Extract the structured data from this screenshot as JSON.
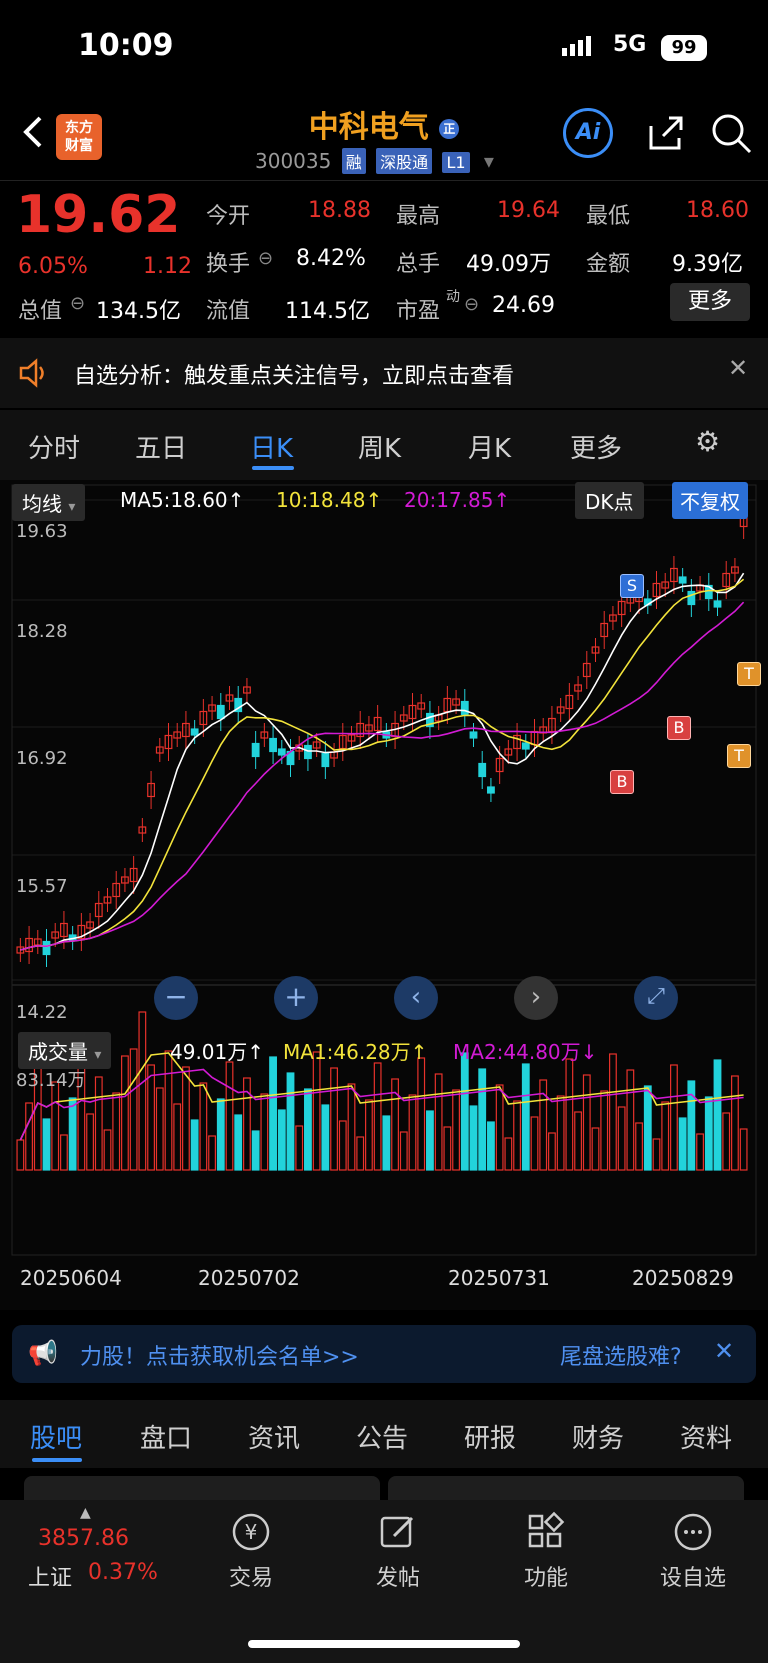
{
  "status_bar": {
    "time": "10:09",
    "network": "5G",
    "battery": "99"
  },
  "header": {
    "app_logo": "东方\n财富",
    "stock_name": "中科电气",
    "stock_code": "300035",
    "tags": [
      "融",
      "深股通",
      "L1"
    ],
    "ai_label": "Ai"
  },
  "quote": {
    "price": "19.62",
    "change_pct": "6.05%",
    "change": "1.12",
    "open_label": "今开",
    "open": "18.88",
    "high_label": "最高",
    "high": "19.64",
    "low_label": "最低",
    "low": "18.60",
    "turnover_label": "换手",
    "turnover": "8.42%",
    "volume_label": "总手",
    "volume": "49.09万",
    "amount_label": "金额",
    "amount": "9.39亿",
    "mktcap_label": "总值",
    "mktcap": "134.5亿",
    "float_label": "流值",
    "float": "114.5亿",
    "pe_label": "市盈",
    "pe_sup": "动",
    "pe": "24.69",
    "more": "更多"
  },
  "alert": {
    "text": "自选分析：触发重点关注信号，立即点击查看"
  },
  "chart_tabs": [
    "分时",
    "五日",
    "日K",
    "周K",
    "月K",
    "更多"
  ],
  "active_chart_tab": "日K",
  "chart": {
    "indicator_select": "均线",
    "ma5": "MA5:18.60",
    "ma10": "10:18.48",
    "ma20": "20:17.85",
    "dk_button": "DK点",
    "fq_button": "不复权",
    "y_labels": [
      "19.63",
      "18.28",
      "16.92",
      "15.57",
      "14.22"
    ],
    "volume_select": "成交量",
    "vol": "49.01万",
    "vol_ma1": "MA1:46.28万",
    "vol_ma2": "MA2:44.80万",
    "vol_top": "83.14万",
    "dates": [
      "20250604",
      "20250702",
      "20250731",
      "20250829"
    ],
    "markers": {
      "s": "S",
      "b": "B",
      "t": "T"
    },
    "colors": {
      "up": "#e8322b",
      "down": "#22d3db",
      "ma5": "#ffffff",
      "ma10": "#f2e33b",
      "ma20": "#d21bd4"
    }
  },
  "banner": {
    "text": "力股！点击获取机会名单>>",
    "right": "尾盘选股难?"
  },
  "bottom_tabs": [
    "股吧",
    "盘口",
    "资讯",
    "公告",
    "研报",
    "财务",
    "资料"
  ],
  "active_bottom_tab": "股吧",
  "footer": {
    "index_value": "3857.86",
    "index_name": "上证",
    "index_change": "0.37%",
    "items": [
      "交易",
      "发帖",
      "功能",
      "设自选"
    ]
  }
}
